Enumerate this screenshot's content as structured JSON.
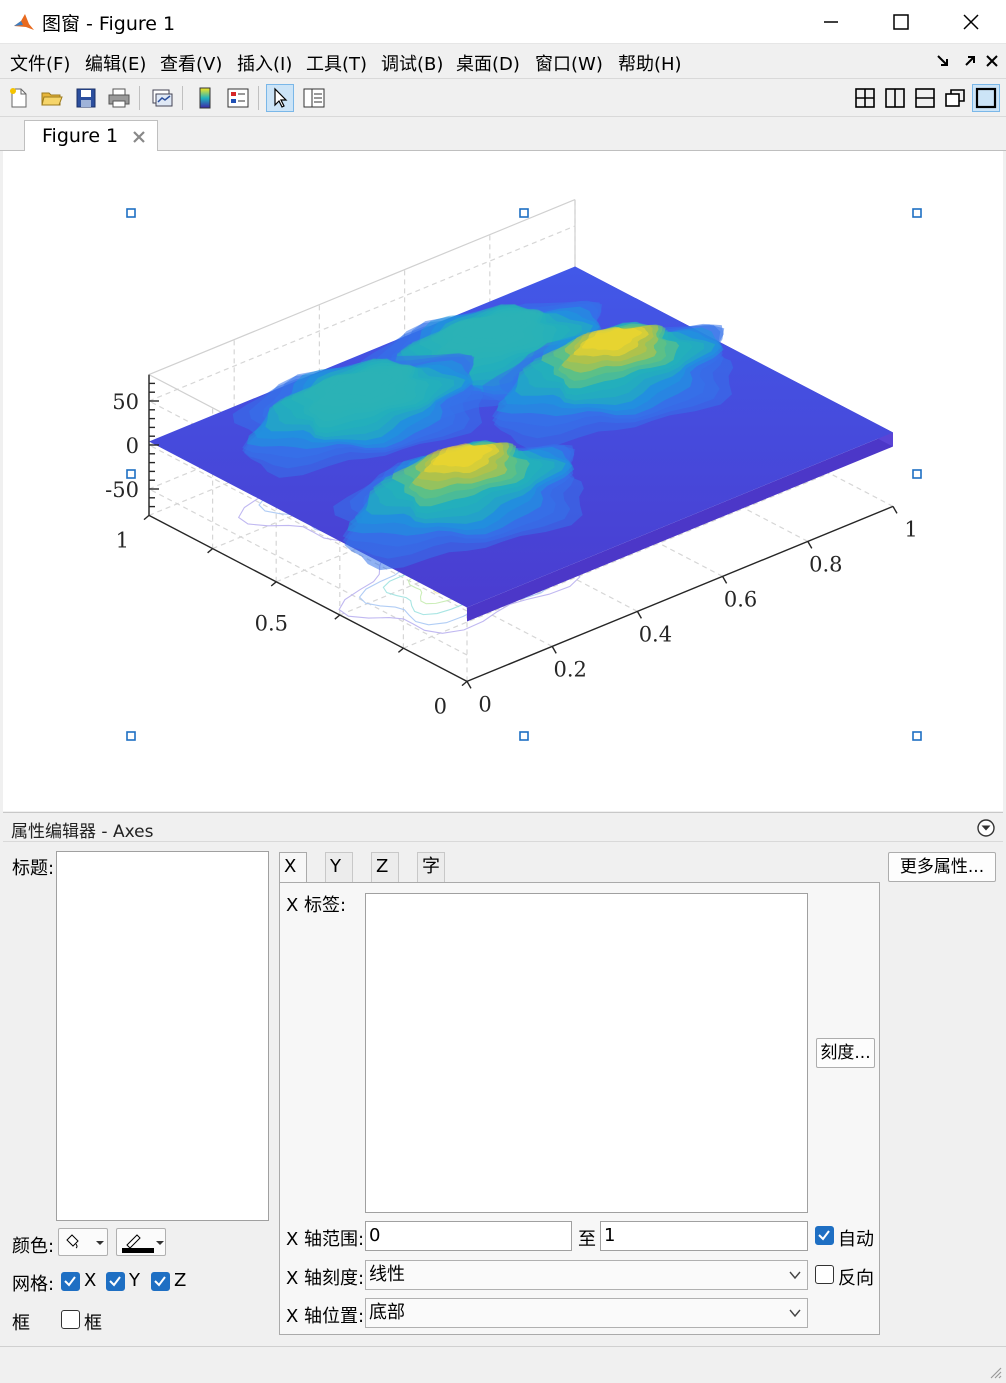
{
  "window": {
    "title": "图窗 - Figure 1"
  },
  "menubar": {
    "items": [
      "文件(F)",
      "编辑(E)",
      "查看(V)",
      "插入(I)",
      "工具(T)",
      "调试(B)",
      "桌面(D)",
      "窗口(W)",
      "帮助(H)"
    ]
  },
  "toolbar": {
    "icons": [
      "new-figure-icon",
      "open-file-icon",
      "save-icon",
      "print-icon",
      "link-plot-icon",
      "insert-colorbar-icon",
      "insert-legend-icon",
      "edit-plot-arrow-icon",
      "property-inspector-icon"
    ],
    "layout_icons": [
      "grid-2x2-icon",
      "columns-2-icon",
      "rows-2-icon",
      "float-icon",
      "maximize-icon"
    ]
  },
  "tab": {
    "label": "Figure 1"
  },
  "chart_data": {
    "type": "surface",
    "colormap": "parula",
    "z_ticks": [
      "50",
      "0",
      "-50"
    ],
    "y_ticks": [
      "1",
      "0.5",
      "0"
    ],
    "x_ticks": [
      "0",
      "0.2",
      "0.4",
      "0.6",
      "0.8",
      "1"
    ],
    "xlim": [
      0,
      1
    ],
    "ylim": [
      0,
      1
    ],
    "zlim": [
      -80,
      80
    ],
    "grid": true,
    "contour_projection": true,
    "peaks": [
      {
        "x": 0.25,
        "y": 0.35,
        "z": 65
      },
      {
        "x": 0.75,
        "y": 0.55,
        "z": 60
      },
      {
        "x": 0.65,
        "y": 0.8,
        "z": 45
      },
      {
        "x": 0.35,
        "y": 0.8,
        "z": 40
      }
    ]
  },
  "property_editor": {
    "header": "属性编辑器 - Axes",
    "title_label": "标题:",
    "color_label": "颜色:",
    "grid_label": "网格:",
    "grid_x": "X",
    "grid_y": "Y",
    "grid_z": "Z",
    "box_label": "框",
    "box_check": "框",
    "tabs": [
      "X 轴",
      "Y 轴",
      "Z 轴",
      "字体"
    ],
    "more_props": "更多属性...",
    "x_label_label": "X 标签:",
    "ticks_button": "刻度...",
    "x_range_label": "X 轴范围:",
    "x_range_from": "0",
    "range_to": "至",
    "x_range_to": "1",
    "auto_label": "自动",
    "x_scale_label": "X 轴刻度:",
    "x_scale_value": "线性",
    "reverse_label": "反向",
    "x_location_label": "X 轴位置:",
    "x_location_value": "底部"
  },
  "colors": {
    "selection_handle": "#1e6fc3",
    "accent": "#1e6fc3"
  }
}
